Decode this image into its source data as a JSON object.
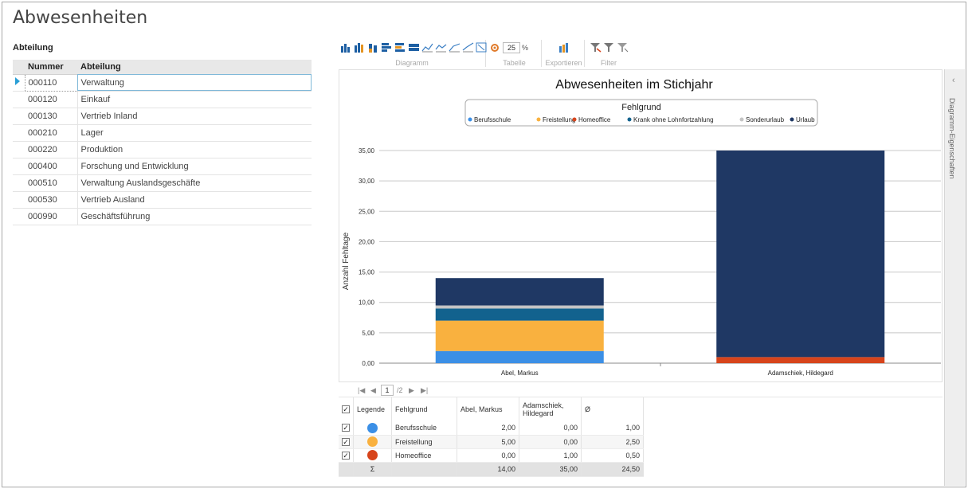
{
  "page_title": "Abwesenheiten",
  "dept_section_label": "Abteilung",
  "grid": {
    "headers": [
      "Nummer",
      "Abteilung"
    ],
    "rows": [
      {
        "num": "000110",
        "name": "Verwaltung"
      },
      {
        "num": "000120",
        "name": "Einkauf"
      },
      {
        "num": "000130",
        "name": "Vertrieb Inland"
      },
      {
        "num": "000210",
        "name": "Lager"
      },
      {
        "num": "000220",
        "name": "Produktion"
      },
      {
        "num": "000400",
        "name": "Forschung und Entwicklung"
      },
      {
        "num": "000510",
        "name": "Verwaltung Auslandsgeschäfte"
      },
      {
        "num": "000530",
        "name": "Vertrieb Ausland"
      },
      {
        "num": "000990",
        "name": "Geschäftsführung"
      }
    ]
  },
  "toolbar": {
    "zoom_value": "25",
    "zoom_unit": "%",
    "groups": [
      "Diagramm",
      "Tabelle",
      "Exportieren",
      "Filter"
    ]
  },
  "side_panel": {
    "label": "Diagramm-Eigenschaften",
    "collapse_icon": "chevron-left-icon"
  },
  "chart_data": {
    "type": "bar",
    "stacked": true,
    "title": "Abwesenheiten im Stichjahr",
    "legend_title": "Fehlgrund",
    "legend_position": "top-center",
    "categories": [
      "Abel, Markus",
      "Adamschiek, Hildegard"
    ],
    "ylabel": "Anzahl Fehltage",
    "xlabel": "",
    "ylim": [
      0,
      35
    ],
    "yticks": [
      "0,00",
      "5,00",
      "10,00",
      "15,00",
      "20,00",
      "25,00",
      "30,00",
      "35,00"
    ],
    "grid": true,
    "series": [
      {
        "name": "Berufsschule",
        "color": "#3b8fe6",
        "values": [
          2,
          0
        ]
      },
      {
        "name": "Freistellung",
        "color": "#f9b13f",
        "values": [
          5,
          0
        ]
      },
      {
        "name": "Homeoffice",
        "color": "#d7441b",
        "values": [
          0,
          1
        ]
      },
      {
        "name": "Krank ohne Lohnfortzahlung",
        "color": "#12628e",
        "values": [
          2,
          0
        ]
      },
      {
        "name": "Sonderurlaub",
        "color": "#c4c4c4",
        "values": [
          0.5,
          0
        ]
      },
      {
        "name": "Urlaub",
        "color": "#1f3864",
        "values": [
          4.5,
          34
        ]
      }
    ]
  },
  "pager": {
    "current": "1",
    "total": "/2"
  },
  "table": {
    "headers": [
      "Legende",
      "Fehlgrund",
      "Abel, Markus",
      "Adamschiek, Hildegard",
      "Ø"
    ],
    "rows": [
      {
        "grund": "Berufsschule",
        "color": "#3b8fe6",
        "a": "2,00",
        "b": "0,00",
        "avg": "1,00"
      },
      {
        "grund": "Freistellung",
        "color": "#f9b13f",
        "a": "5,00",
        "b": "0,00",
        "avg": "2,50"
      },
      {
        "grund": "Homeoffice",
        "color": "#d7441b",
        "a": "0,00",
        "b": "1,00",
        "avg": "0,50"
      }
    ],
    "sum_label": "Σ",
    "sum": {
      "a": "14,00",
      "b": "35,00",
      "avg": "24,50"
    }
  }
}
